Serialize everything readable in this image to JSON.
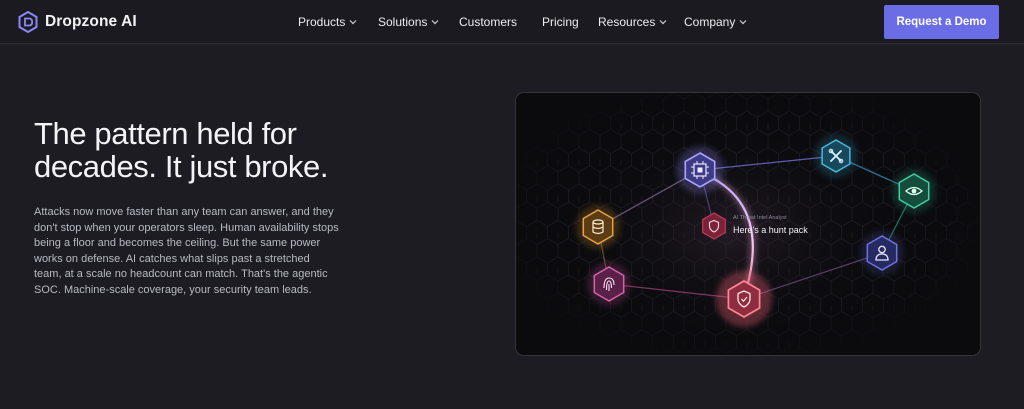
{
  "brand": {
    "name": "Dropzone AI",
    "icon": "dropzone-logo-icon"
  },
  "nav": {
    "items": [
      {
        "label": "Products",
        "dropdown": true
      },
      {
        "label": "Solutions",
        "dropdown": true
      },
      {
        "label": "Customers",
        "dropdown": false
      },
      {
        "label": "Pricing",
        "dropdown": false
      },
      {
        "label": "Resources",
        "dropdown": true
      },
      {
        "label": "Company",
        "dropdown": true
      }
    ],
    "cta": "Request a Demo"
  },
  "hero": {
    "headline_line1": "The pattern held for",
    "headline_line2": "decades. It just broke.",
    "body": "Attacks now move faster than any team can answer, and they don't stop when your operators sleep. Human availability stops being a floor and becomes the ceiling. But the same power works on defense. AI catches what slips past a stretched team, at a scale no headcount can match. That's the agentic SOC. Machine-scale coverage, your security team leads."
  },
  "graphic": {
    "card_caption": "AI Threat Intel Analyst",
    "card_text": "Here's a hunt pack",
    "nodes": [
      {
        "name": "network-chip-icon",
        "color": "#8b84f0"
      },
      {
        "name": "tools-icon",
        "color": "#3aa3c9"
      },
      {
        "name": "eye-icon",
        "color": "#2fb58a"
      },
      {
        "name": "user-icon",
        "color": "#6066c9"
      },
      {
        "name": "shield-check-icon",
        "color": "#ef5f73"
      },
      {
        "name": "fingerprint-icon",
        "color": "#c04d99"
      },
      {
        "name": "database-icon",
        "color": "#d6902e"
      },
      {
        "name": "shield-icon",
        "color": "#b23a52"
      }
    ]
  },
  "colors": {
    "accent": "#6b6de6",
    "background": "#1c1c22"
  }
}
